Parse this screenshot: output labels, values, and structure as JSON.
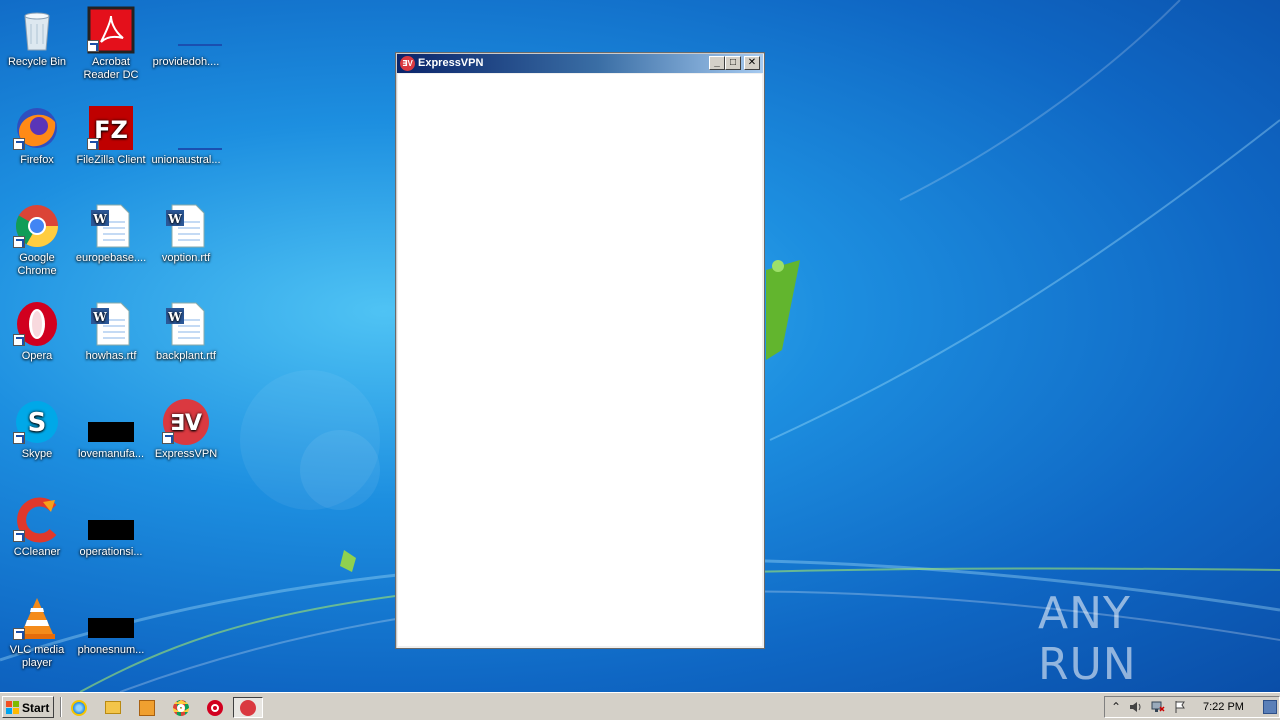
{
  "desktop": {
    "icons": [
      {
        "label": "Recycle Bin",
        "icon": "recycle-bin-icon"
      },
      {
        "label": "Acrobat Reader DC",
        "icon": "acrobat-icon"
      },
      {
        "label": "providedoh....",
        "icon": "file-icon"
      },
      {
        "label": "Firefox",
        "icon": "firefox-icon"
      },
      {
        "label": "FileZilla Client",
        "icon": "filezilla-icon"
      },
      {
        "label": "unionaustral...",
        "icon": "file-icon"
      },
      {
        "label": "Google Chrome",
        "icon": "chrome-icon"
      },
      {
        "label": "europebase....",
        "icon": "word-doc-icon"
      },
      {
        "label": "voption.rtf",
        "icon": "word-doc-icon"
      },
      {
        "label": "Opera",
        "icon": "opera-icon"
      },
      {
        "label": "howhas.rtf",
        "icon": "word-doc-icon"
      },
      {
        "label": "backplant.rtf",
        "icon": "word-doc-icon"
      },
      {
        "label": "Skype",
        "icon": "skype-icon"
      },
      {
        "label": "lovemanufa...",
        "icon": "redacted-file-icon"
      },
      {
        "label": "ExpressVPN",
        "icon": "expressvpn-icon"
      },
      {
        "label": "CCleaner",
        "icon": "ccleaner-icon"
      },
      {
        "label": "operationsi...",
        "icon": "redacted-file-icon"
      },
      {
        "label": "VLC media player",
        "icon": "vlc-icon"
      },
      {
        "label": "phonesnum...",
        "icon": "redacted-file-icon"
      }
    ]
  },
  "window": {
    "title": "ExpressVPN",
    "title_icon_text": "∃V",
    "minimize": "_",
    "maximize": "□",
    "close": "✕"
  },
  "watermark": {
    "text": "ANY RUN"
  },
  "taskbar": {
    "start_label": "Start",
    "clock": "7:22 PM",
    "tray_up": "⌃"
  },
  "colors": {
    "expressvpn_red": "#da3940",
    "titlebar_start": "#0a246a",
    "titlebar_end": "#a6caf0",
    "taskbar": "#d4d0c8"
  }
}
